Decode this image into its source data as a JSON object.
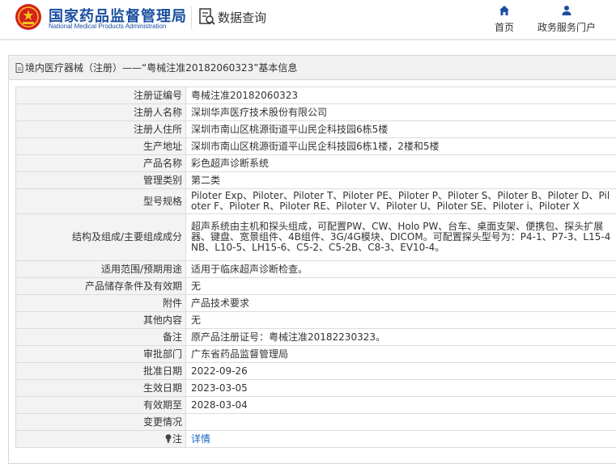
{
  "header": {
    "site_title_cn": "国家药品监督管理局",
    "site_title_en": "National Medical Products Administration",
    "data_query_label": "数据查询",
    "nav": [
      {
        "label": "首页",
        "icon": "home-icon"
      },
      {
        "label": "政务服务门户",
        "icon": "user-icon"
      }
    ]
  },
  "panel": {
    "title": "境内医疗器械（注册）——“粤械注准20182060323”基本信息"
  },
  "rows": [
    {
      "label": "注册证编号",
      "value": "粤械注准20182060323"
    },
    {
      "label": "注册人名称",
      "value": "深圳华声医疗技术股份有限公司"
    },
    {
      "label": "注册人住所",
      "value": "深圳市南山区桃源街道平山民企科技园6栋5楼"
    },
    {
      "label": "生产地址",
      "value": "深圳市南山区桃源街道平山民企科技园6栋1楼，2楼和5楼"
    },
    {
      "label": "产品名称",
      "value": "彩色超声诊断系统"
    },
    {
      "label": "管理类别",
      "value": "第二类"
    },
    {
      "label": "型号规格",
      "value": "Piloter Exp、Piloter、Piloter T、Piloter PE、Piloter P、Piloter S、Piloter B、Piloter D、Piloter F、Piloter R、Piloter RE、Piloter V、Piloter U、Piloter SE、Piloter i、Piloter X"
    },
    {
      "label": "结构及组成/主要组成成分",
      "value": "超声系统由主机和探头组成，可配置PW、CW、Holo PW、台车、桌面支架、便携包、探头扩展器、键盘、宽景组件、4B组件、3G/4G模块、DICOM。可配置探头型号为：P4-1、P7-3、L15-4NB、L10-5、LH15-6、C5-2、C5-2B、C8-3、EV10-4。"
    },
    {
      "label": "适用范围/预期用途",
      "value": "适用于临床超声诊断检查。"
    },
    {
      "label": "产品储存条件及有效期",
      "value": "无"
    },
    {
      "label": "附件",
      "value": "产品技术要求"
    },
    {
      "label": "其他内容",
      "value": "无"
    },
    {
      "label": "备注",
      "value": "原产品注册证号：粤械注准20182230323。"
    },
    {
      "label": "审批部门",
      "value": "广东省药品监督管理局"
    },
    {
      "label": "批准日期",
      "value": "2022-09-26"
    },
    {
      "label": "生效日期",
      "value": "2023-03-05"
    },
    {
      "label": "有效期至",
      "value": "2028-03-04"
    },
    {
      "label": "变更情况",
      "value": ""
    },
    {
      "label": "注",
      "value": "详情"
    }
  ]
}
